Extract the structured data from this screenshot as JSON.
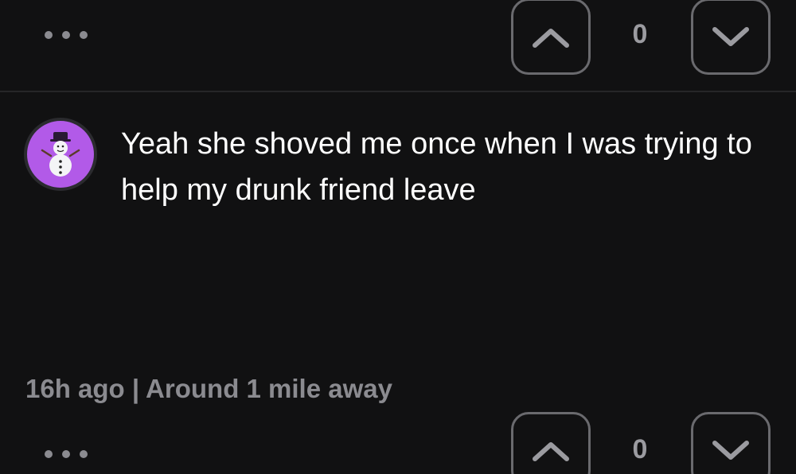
{
  "top_actions": {
    "upvote_icon": "chevron-up-icon",
    "downvote_icon": "chevron-down-icon",
    "more_icon": "ellipsis-icon",
    "vote_count": "0"
  },
  "comment": {
    "avatar_icon": "snowman-icon",
    "avatar_color": "#b25ae8",
    "text": "Yeah she shoved me once when I was trying to help my drunk friend leave",
    "meta": "16h ago | Around 1 mile away",
    "vote_count": "0",
    "upvote_icon": "chevron-up-icon",
    "downvote_icon": "chevron-down-icon",
    "more_icon": "ellipsis-icon"
  },
  "colors": {
    "background": "#111112",
    "muted_text": "#8b8b90",
    "button_border": "#6a6a6e"
  }
}
